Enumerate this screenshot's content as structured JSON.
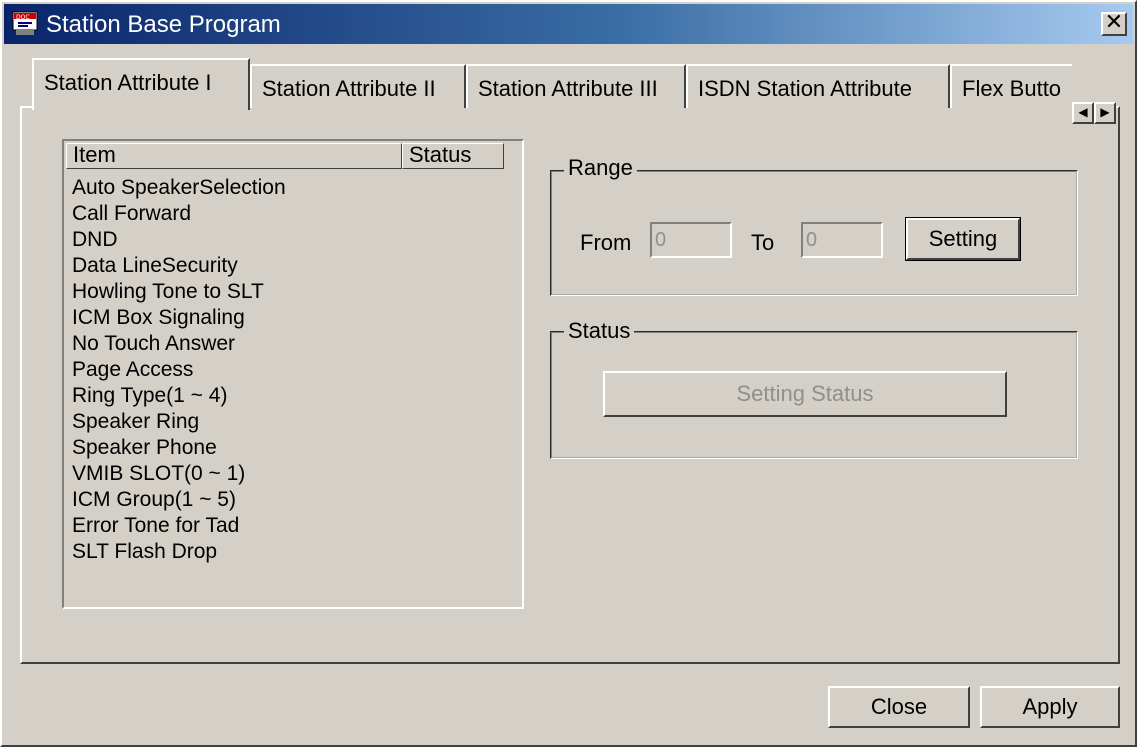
{
  "window": {
    "title": "Station Base Program",
    "close_glyph": "✕"
  },
  "tabs": [
    {
      "label": "Station Attribute I",
      "active": true
    },
    {
      "label": "Station Attribute II",
      "active": false
    },
    {
      "label": "Station Attribute III",
      "active": false
    },
    {
      "label": "ISDN Station Attribute",
      "active": false
    },
    {
      "label": "Flex Butto",
      "active": false
    }
  ],
  "tab_scroll": {
    "left_glyph": "◀",
    "right_glyph": "▶"
  },
  "list": {
    "columns": [
      "Item",
      "Status"
    ],
    "items": [
      "Auto SpeakerSelection",
      "Call Forward",
      "DND",
      "Data LineSecurity",
      "Howling Tone to SLT",
      "ICM Box Signaling",
      "No Touch Answer",
      "Page Access",
      "Ring Type(1 ~ 4)",
      "Speaker Ring",
      "Speaker Phone",
      "VMIB SLOT(0 ~ 1)",
      "ICM Group(1 ~ 5)",
      "Error Tone for Tad",
      "SLT Flash Drop"
    ]
  },
  "range": {
    "group_label": "Range",
    "from_label": "From",
    "from_value": "0",
    "to_label": "To",
    "to_value": "0",
    "setting_button": "Setting"
  },
  "status": {
    "group_label": "Status",
    "setting_status_button": "Setting Status"
  },
  "footer": {
    "close_button": "Close",
    "apply_button": "Apply"
  },
  "icons": {
    "title_icon": "doc-app-icon"
  },
  "colors": {
    "titlebar_start": "#0a246a",
    "titlebar_end": "#a6caf0",
    "face": "#d4d0c8"
  }
}
